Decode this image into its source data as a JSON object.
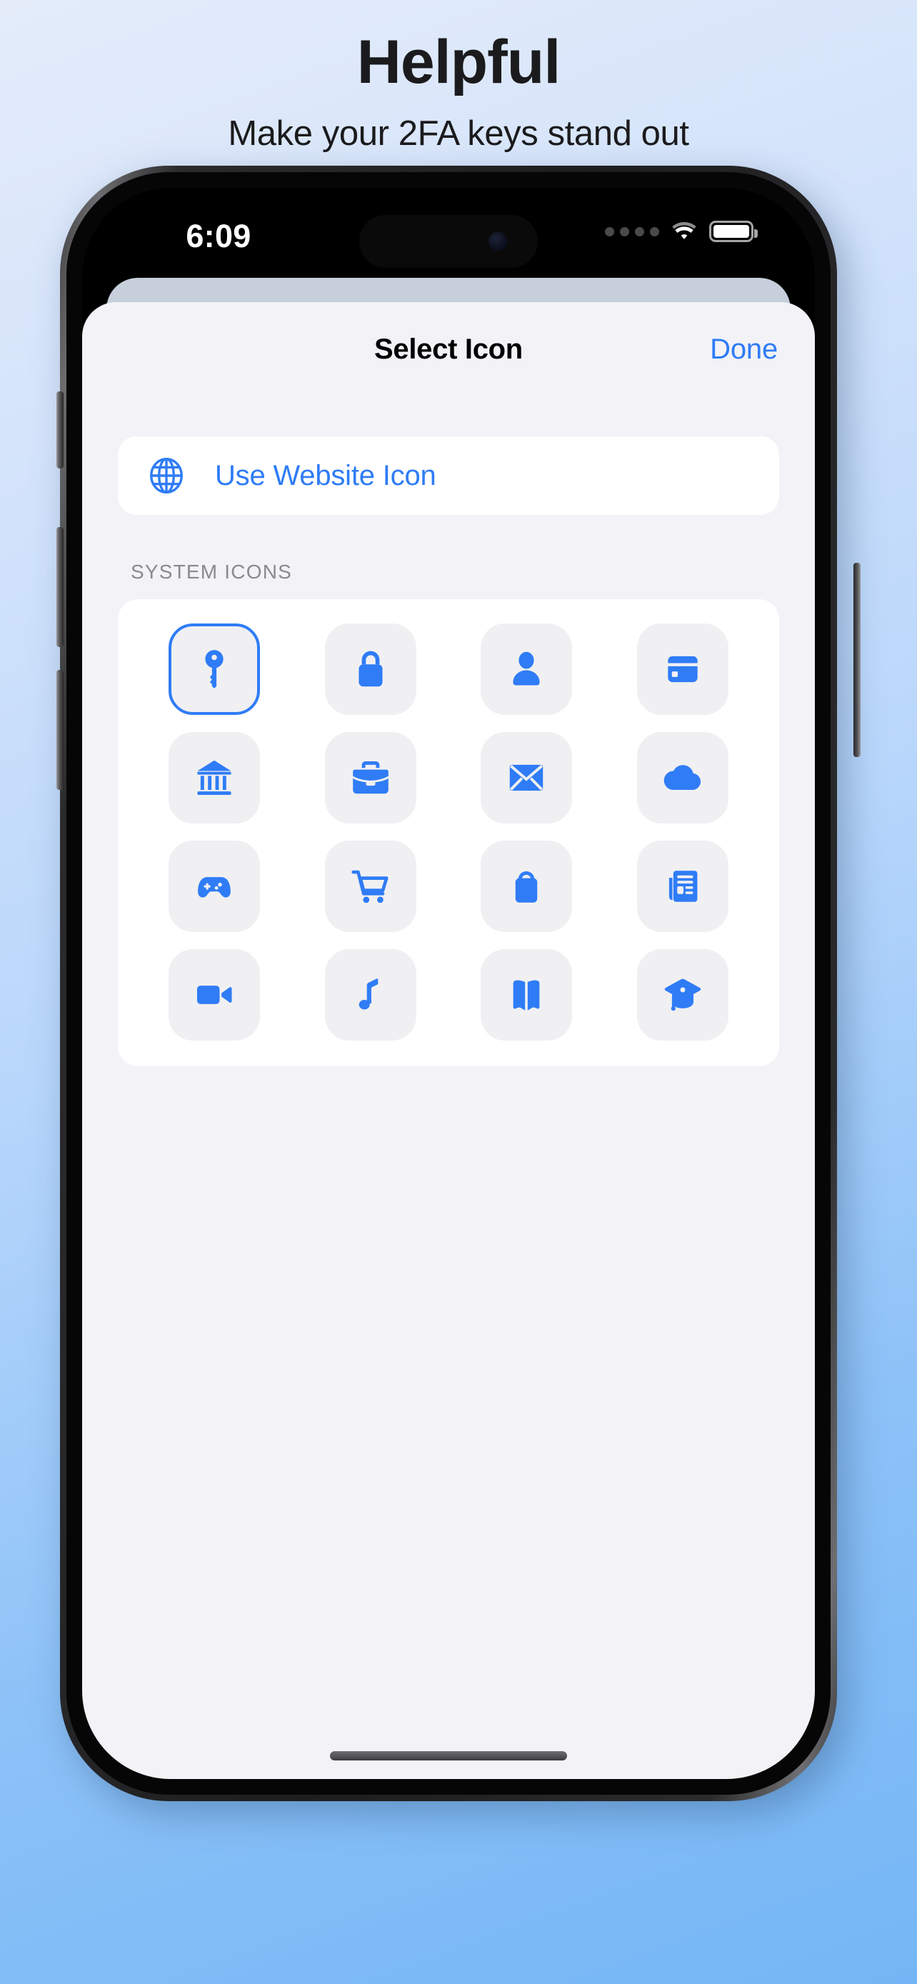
{
  "promo": {
    "title": "Helpful",
    "subtitle": "Make your 2FA keys stand out"
  },
  "status_bar": {
    "time": "6:09",
    "cellular_dots": 4,
    "wifi_icon": "wifi-icon",
    "battery_icon": "battery-full-icon",
    "battery_level_percent": 100
  },
  "sheet": {
    "title": "Select Icon",
    "done_label": "Done",
    "website_row": {
      "icon": "globe-icon",
      "label": "Use Website Icon"
    },
    "section_header": "SYSTEM ICONS",
    "icons": [
      {
        "name": "key-icon",
        "selected": true
      },
      {
        "name": "lock-icon",
        "selected": false
      },
      {
        "name": "person-icon",
        "selected": false
      },
      {
        "name": "credit-card-icon",
        "selected": false
      },
      {
        "name": "bank-icon",
        "selected": false
      },
      {
        "name": "briefcase-icon",
        "selected": false
      },
      {
        "name": "envelope-icon",
        "selected": false
      },
      {
        "name": "cloud-icon",
        "selected": false
      },
      {
        "name": "gamepad-icon",
        "selected": false
      },
      {
        "name": "shopping-cart-icon",
        "selected": false
      },
      {
        "name": "shopping-bag-icon",
        "selected": false
      },
      {
        "name": "newspaper-icon",
        "selected": false
      },
      {
        "name": "video-camera-icon",
        "selected": false
      },
      {
        "name": "music-note-icon",
        "selected": false
      },
      {
        "name": "book-icon",
        "selected": false
      },
      {
        "name": "graduation-cap-icon",
        "selected": false
      }
    ],
    "home_indicator": "home-indicator"
  },
  "colors": {
    "accent_blue": "#2f7cf6",
    "sheet_background": "#f2f2f7",
    "card_background": "#ffffff",
    "icon_tile_background": "#f0f0f2",
    "section_header_text": "#8a8a8e",
    "promo_text": "#1b1b1d",
    "page_gradient_top": "#e4ecfa",
    "page_gradient_bottom": "#74b6f5"
  }
}
